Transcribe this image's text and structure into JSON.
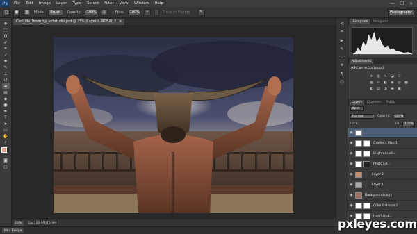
{
  "app": {
    "logo": "Ps"
  },
  "menubar": {
    "menus": [
      "File",
      "Edit",
      "Image",
      "Layer",
      "Type",
      "Select",
      "Filter",
      "View",
      "Window",
      "Help"
    ],
    "window_controls": [
      "—",
      "❐",
      "✕"
    ]
  },
  "options": {
    "mode_label": "Mode:",
    "mode_value": "Brush",
    "opacity_label": "Opacity:",
    "opacity_value": "100%",
    "flow_label": "Flow:",
    "flow_value": "100%",
    "erase_history": "Erase to History",
    "workspace": "Photography"
  },
  "document": {
    "tab_title": "Cool_Me_Down_by_vebstudio.psd @ 25% (Layer 4, RGB/8) *",
    "close": "×",
    "zoom": "25%",
    "doc_info": "Doc: 20.9M/75.9M"
  },
  "bottom": {
    "mini_bridge": "Mini Bridge"
  },
  "panels": {
    "histogram_tabs": [
      "Histogram",
      "Navigator"
    ],
    "adjust_tabs": [
      "Adjustments"
    ],
    "adjust_title": "Add an adjustment",
    "layers_tabs": [
      "Layers",
      "Channels",
      "Paths"
    ],
    "kind": "Kind",
    "blend_mode": "Normal",
    "opacity_label": "Opacity:",
    "opacity_value": "100%",
    "lock_label": "Lock:",
    "fill_label": "Fill:",
    "fill_value": "100%",
    "layers": [
      {
        "name": "Gradient Map 1",
        "thumb": "#ffffff"
      },
      {
        "name": "Brightness/C...",
        "thumb": "#ffffff"
      },
      {
        "name": "Photo Filt...",
        "thumb": "#ffffff"
      },
      {
        "name": "Layer 2",
        "thumb": "#c09070"
      },
      {
        "name": "Layer 1",
        "thumb": "#aaaaaa"
      },
      {
        "name": "Background copy",
        "thumb": "#a07060"
      },
      {
        "name": "Color Balance 1",
        "thumb": "#ffffff"
      },
      {
        "name": "Hue/Satur...",
        "thumb": "#ffffff"
      }
    ]
  },
  "watermark": {
    "text": "pxleyes.com"
  }
}
